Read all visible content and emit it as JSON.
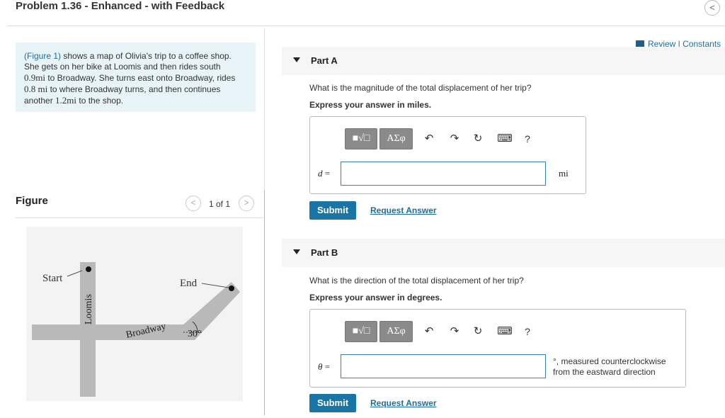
{
  "header": {
    "title": "Problem 1.36 - Enhanced - with Feedback",
    "back_glyph": "<"
  },
  "intro": {
    "link": "(Figure 1)",
    "line1_rest": " shows a map of Olivia's trip to a coffee shop.",
    "line2": "She gets on her bike at Loomis and then rides south",
    "line3_num": "0.9mi",
    "line3_rest": " to Broadway. She turns east onto Broadway, rides",
    "line4_num": "0.8 mi",
    "line4_rest": " to where Broadway turns, and then continues",
    "line5_pre": "another ",
    "line5_num": "1.2mi",
    "line5_rest": " to the shop."
  },
  "figure": {
    "label": "Figure",
    "pager_text": "1 of 1",
    "prev_glyph": "<",
    "next_glyph": ">",
    "labels": {
      "start": "Start",
      "end": "End",
      "loomis": "Loomis",
      "broadway": "Broadway",
      "angle": "30°"
    }
  },
  "review": {
    "text": "Review | Constants"
  },
  "toolbar": {
    "templates_glyph": "■√□",
    "greek_glyph": "ΑΣφ",
    "undo_glyph": "↶",
    "redo_glyph": "↷",
    "reset_glyph": "↻",
    "keyboard_glyph": "⌨",
    "help_glyph": "?"
  },
  "partA": {
    "label": "Part A",
    "question": "What is the magnitude of the total displacement of her trip?",
    "instruction": "Express your answer in miles.",
    "variable": "d",
    "equals": "=",
    "value": "",
    "unit": "mi",
    "submit": "Submit",
    "request": "Request Answer"
  },
  "partB": {
    "label": "Part B",
    "question": "What is the direction of the total displacement of her trip?",
    "instruction": "Express your answer in degrees.",
    "variable": "θ",
    "equals": "=",
    "value": "",
    "unit_line1": "°, measured counterclockwise",
    "unit_line2": "from the eastward direction",
    "submit": "Submit",
    "request": "Request Answer"
  }
}
